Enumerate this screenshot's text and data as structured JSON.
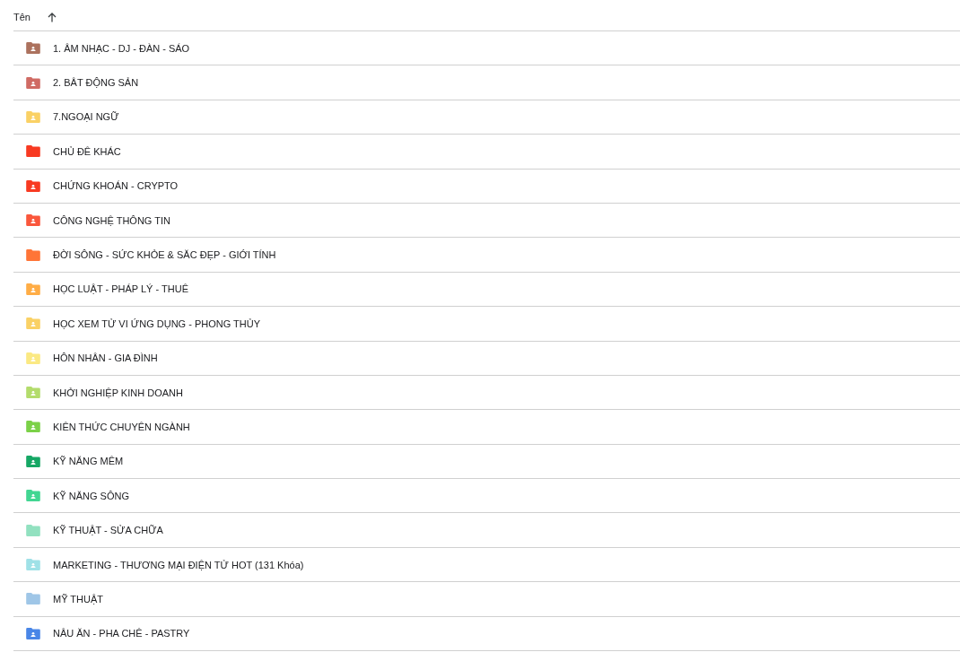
{
  "header": {
    "label": "Tên",
    "sort_ascending": true
  },
  "items": [
    {
      "name": "1. ÂM NHẠC - DJ - ĐÀN - SÁO",
      "kind": "shared-folder",
      "color": "#ac725e"
    },
    {
      "name": "2. BÂT ĐỘNG SẢN",
      "kind": "shared-folder",
      "color": "#d06b64"
    },
    {
      "name": "7.NGOẠI NGỮ",
      "kind": "shared-folder",
      "color": "#fad165"
    },
    {
      "name": "CHỦ ĐÊ KHÁC",
      "kind": "folder",
      "color": "#f83a22"
    },
    {
      "name": "CHỨNG KHOÁN - CRYPTO",
      "kind": "shared-folder",
      "color": "#f83a22"
    },
    {
      "name": "CÔNG NGHỆ THÔNG TIN",
      "kind": "shared-folder",
      "color": "#fa573c"
    },
    {
      "name": "ĐỜI SÔNG - SỨC KHỎE & SĂC ĐẸP - GIỚI TÍNH",
      "kind": "folder",
      "color": "#ff7537"
    },
    {
      "name": "HỌC LUẬT - PHÁP LÝ - THUÊ",
      "kind": "shared-folder",
      "color": "#ffad46"
    },
    {
      "name": "HỌC XEM TỬ VI ỨNG DỤNG - PHONG THỦY",
      "kind": "shared-folder",
      "color": "#fad165"
    },
    {
      "name": "HÔN NHÂN - GIA ĐÌNH",
      "kind": "shared-folder",
      "color": "#fbe983"
    },
    {
      "name": "KHỞI NGHIỆP KINH DOANH",
      "kind": "shared-folder",
      "color": "#b3dc6c"
    },
    {
      "name": "KIÊN THỨC CHUYÊN NGÀNH",
      "kind": "shared-folder",
      "color": "#7bd148"
    },
    {
      "name": "KỸ NĂNG MÊM",
      "kind": "shared-folder",
      "color": "#16a765"
    },
    {
      "name": "KỸ NĂNG SÔNG",
      "kind": "shared-folder",
      "color": "#42d692"
    },
    {
      "name": "KỸ THUẬT - SỬA CHỮA",
      "kind": "folder",
      "color": "#92e1c0"
    },
    {
      "name": "MARKETING - THƯƠNG MẠI ĐIỆN TỬ HOT (131 Khóa)",
      "kind": "shared-folder",
      "color": "#9fe1e7"
    },
    {
      "name": "MỸ THUẬT",
      "kind": "folder",
      "color": "#9fc6e7"
    },
    {
      "name": "NÂU ĂN - PHA CHÊ - PASTRY",
      "kind": "shared-folder",
      "color": "#4986e7"
    }
  ]
}
